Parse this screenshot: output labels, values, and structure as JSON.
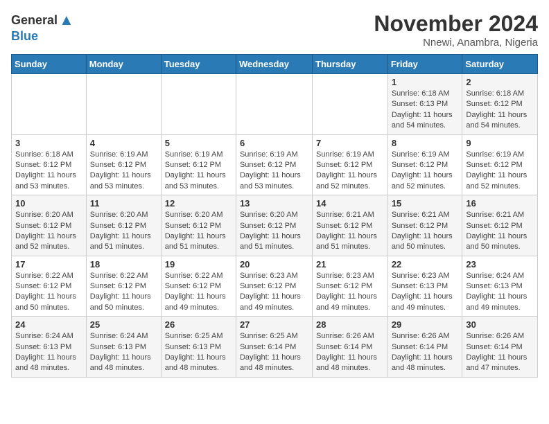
{
  "logo": {
    "general": "General",
    "blue": "Blue"
  },
  "title": "November 2024",
  "location": "Nnewi, Anambra, Nigeria",
  "days_header": [
    "Sunday",
    "Monday",
    "Tuesday",
    "Wednesday",
    "Thursday",
    "Friday",
    "Saturday"
  ],
  "weeks": [
    [
      {
        "day": "",
        "info": ""
      },
      {
        "day": "",
        "info": ""
      },
      {
        "day": "",
        "info": ""
      },
      {
        "day": "",
        "info": ""
      },
      {
        "day": "",
        "info": ""
      },
      {
        "day": "1",
        "info": "Sunrise: 6:18 AM\nSunset: 6:13 PM\nDaylight: 11 hours and 54 minutes."
      },
      {
        "day": "2",
        "info": "Sunrise: 6:18 AM\nSunset: 6:12 PM\nDaylight: 11 hours and 54 minutes."
      }
    ],
    [
      {
        "day": "3",
        "info": "Sunrise: 6:18 AM\nSunset: 6:12 PM\nDaylight: 11 hours and 53 minutes."
      },
      {
        "day": "4",
        "info": "Sunrise: 6:19 AM\nSunset: 6:12 PM\nDaylight: 11 hours and 53 minutes."
      },
      {
        "day": "5",
        "info": "Sunrise: 6:19 AM\nSunset: 6:12 PM\nDaylight: 11 hours and 53 minutes."
      },
      {
        "day": "6",
        "info": "Sunrise: 6:19 AM\nSunset: 6:12 PM\nDaylight: 11 hours and 53 minutes."
      },
      {
        "day": "7",
        "info": "Sunrise: 6:19 AM\nSunset: 6:12 PM\nDaylight: 11 hours and 52 minutes."
      },
      {
        "day": "8",
        "info": "Sunrise: 6:19 AM\nSunset: 6:12 PM\nDaylight: 11 hours and 52 minutes."
      },
      {
        "day": "9",
        "info": "Sunrise: 6:19 AM\nSunset: 6:12 PM\nDaylight: 11 hours and 52 minutes."
      }
    ],
    [
      {
        "day": "10",
        "info": "Sunrise: 6:20 AM\nSunset: 6:12 PM\nDaylight: 11 hours and 52 minutes."
      },
      {
        "day": "11",
        "info": "Sunrise: 6:20 AM\nSunset: 6:12 PM\nDaylight: 11 hours and 51 minutes."
      },
      {
        "day": "12",
        "info": "Sunrise: 6:20 AM\nSunset: 6:12 PM\nDaylight: 11 hours and 51 minutes."
      },
      {
        "day": "13",
        "info": "Sunrise: 6:20 AM\nSunset: 6:12 PM\nDaylight: 11 hours and 51 minutes."
      },
      {
        "day": "14",
        "info": "Sunrise: 6:21 AM\nSunset: 6:12 PM\nDaylight: 11 hours and 51 minutes."
      },
      {
        "day": "15",
        "info": "Sunrise: 6:21 AM\nSunset: 6:12 PM\nDaylight: 11 hours and 50 minutes."
      },
      {
        "day": "16",
        "info": "Sunrise: 6:21 AM\nSunset: 6:12 PM\nDaylight: 11 hours and 50 minutes."
      }
    ],
    [
      {
        "day": "17",
        "info": "Sunrise: 6:22 AM\nSunset: 6:12 PM\nDaylight: 11 hours and 50 minutes."
      },
      {
        "day": "18",
        "info": "Sunrise: 6:22 AM\nSunset: 6:12 PM\nDaylight: 11 hours and 50 minutes."
      },
      {
        "day": "19",
        "info": "Sunrise: 6:22 AM\nSunset: 6:12 PM\nDaylight: 11 hours and 49 minutes."
      },
      {
        "day": "20",
        "info": "Sunrise: 6:23 AM\nSunset: 6:12 PM\nDaylight: 11 hours and 49 minutes."
      },
      {
        "day": "21",
        "info": "Sunrise: 6:23 AM\nSunset: 6:12 PM\nDaylight: 11 hours and 49 minutes."
      },
      {
        "day": "22",
        "info": "Sunrise: 6:23 AM\nSunset: 6:13 PM\nDaylight: 11 hours and 49 minutes."
      },
      {
        "day": "23",
        "info": "Sunrise: 6:24 AM\nSunset: 6:13 PM\nDaylight: 11 hours and 49 minutes."
      }
    ],
    [
      {
        "day": "24",
        "info": "Sunrise: 6:24 AM\nSunset: 6:13 PM\nDaylight: 11 hours and 48 minutes."
      },
      {
        "day": "25",
        "info": "Sunrise: 6:24 AM\nSunset: 6:13 PM\nDaylight: 11 hours and 48 minutes."
      },
      {
        "day": "26",
        "info": "Sunrise: 6:25 AM\nSunset: 6:13 PM\nDaylight: 11 hours and 48 minutes."
      },
      {
        "day": "27",
        "info": "Sunrise: 6:25 AM\nSunset: 6:14 PM\nDaylight: 11 hours and 48 minutes."
      },
      {
        "day": "28",
        "info": "Sunrise: 6:26 AM\nSunset: 6:14 PM\nDaylight: 11 hours and 48 minutes."
      },
      {
        "day": "29",
        "info": "Sunrise: 6:26 AM\nSunset: 6:14 PM\nDaylight: 11 hours and 48 minutes."
      },
      {
        "day": "30",
        "info": "Sunrise: 6:26 AM\nSunset: 6:14 PM\nDaylight: 11 hours and 47 minutes."
      }
    ]
  ]
}
